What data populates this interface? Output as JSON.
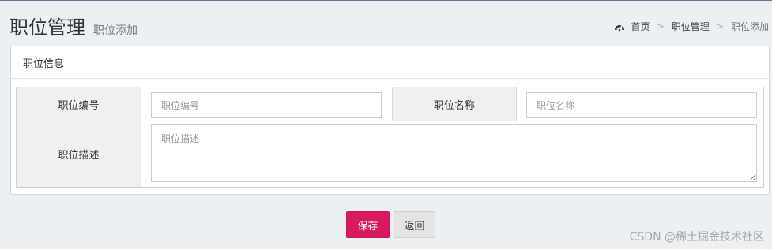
{
  "header": {
    "title": "职位管理",
    "subtitle": "职位添加"
  },
  "breadcrumb": {
    "icon": "dashboard-icon",
    "items": [
      "首页",
      "职位管理",
      "职位添加"
    ],
    "separator": ">"
  },
  "box": {
    "title": "职位信息"
  },
  "form": {
    "code_label": "职位编号",
    "code_value": "",
    "code_placeholder": "职位编号",
    "name_label": "职位名称",
    "name_value": "",
    "name_placeholder": "职位名称",
    "desc_label": "职位描述",
    "desc_value": "",
    "desc_placeholder": "职位描述"
  },
  "actions": {
    "save_label": "保存",
    "back_label": "返回"
  },
  "watermark": "CSDN @稀土掘金技术社区",
  "colors": {
    "background": "#ecf0f5",
    "save_button": "#d81b60",
    "back_button": "#e4e4e4",
    "label_cell": "#f0f0f0"
  }
}
